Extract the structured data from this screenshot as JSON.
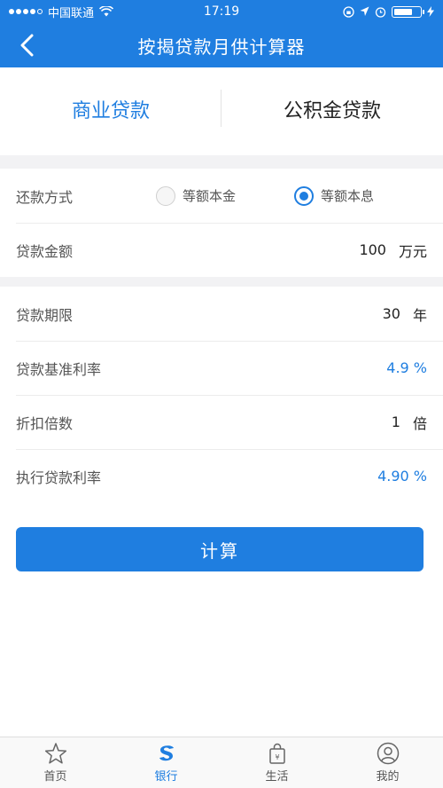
{
  "status_bar": {
    "carrier": "中国联通",
    "time": "17:19"
  },
  "nav": {
    "title": "按揭贷款月供计算器"
  },
  "tabs": [
    {
      "label": "商业贷款",
      "active": true
    },
    {
      "label": "公积金贷款",
      "active": false
    }
  ],
  "repayment": {
    "label": "还款方式",
    "options": [
      {
        "label": "等额本金",
        "checked": false
      },
      {
        "label": "等额本息",
        "checked": true
      }
    ]
  },
  "loan_amount": {
    "label": "贷款金额",
    "value": "100",
    "unit": "万元"
  },
  "loan_term": {
    "label": "贷款期限",
    "value": "30",
    "unit": "年"
  },
  "base_rate": {
    "label": "贷款基准利率",
    "value": "4.9 %"
  },
  "discount": {
    "label": "折扣倍数",
    "value": "1",
    "unit": "倍"
  },
  "exec_rate": {
    "label": "执行贷款利率",
    "value": "4.90 %"
  },
  "calculate_button": {
    "label": "计算"
  },
  "tabbar": [
    {
      "label": "首页",
      "icon": "star-icon",
      "active": false
    },
    {
      "label": "银行",
      "icon": "bank-logo-icon",
      "active": true
    },
    {
      "label": "生活",
      "icon": "shopping-bag-icon",
      "active": false
    },
    {
      "label": "我的",
      "icon": "user-icon",
      "active": false
    }
  ],
  "colors": {
    "primary": "#1f7ee0",
    "background": "#f2f2f4"
  }
}
